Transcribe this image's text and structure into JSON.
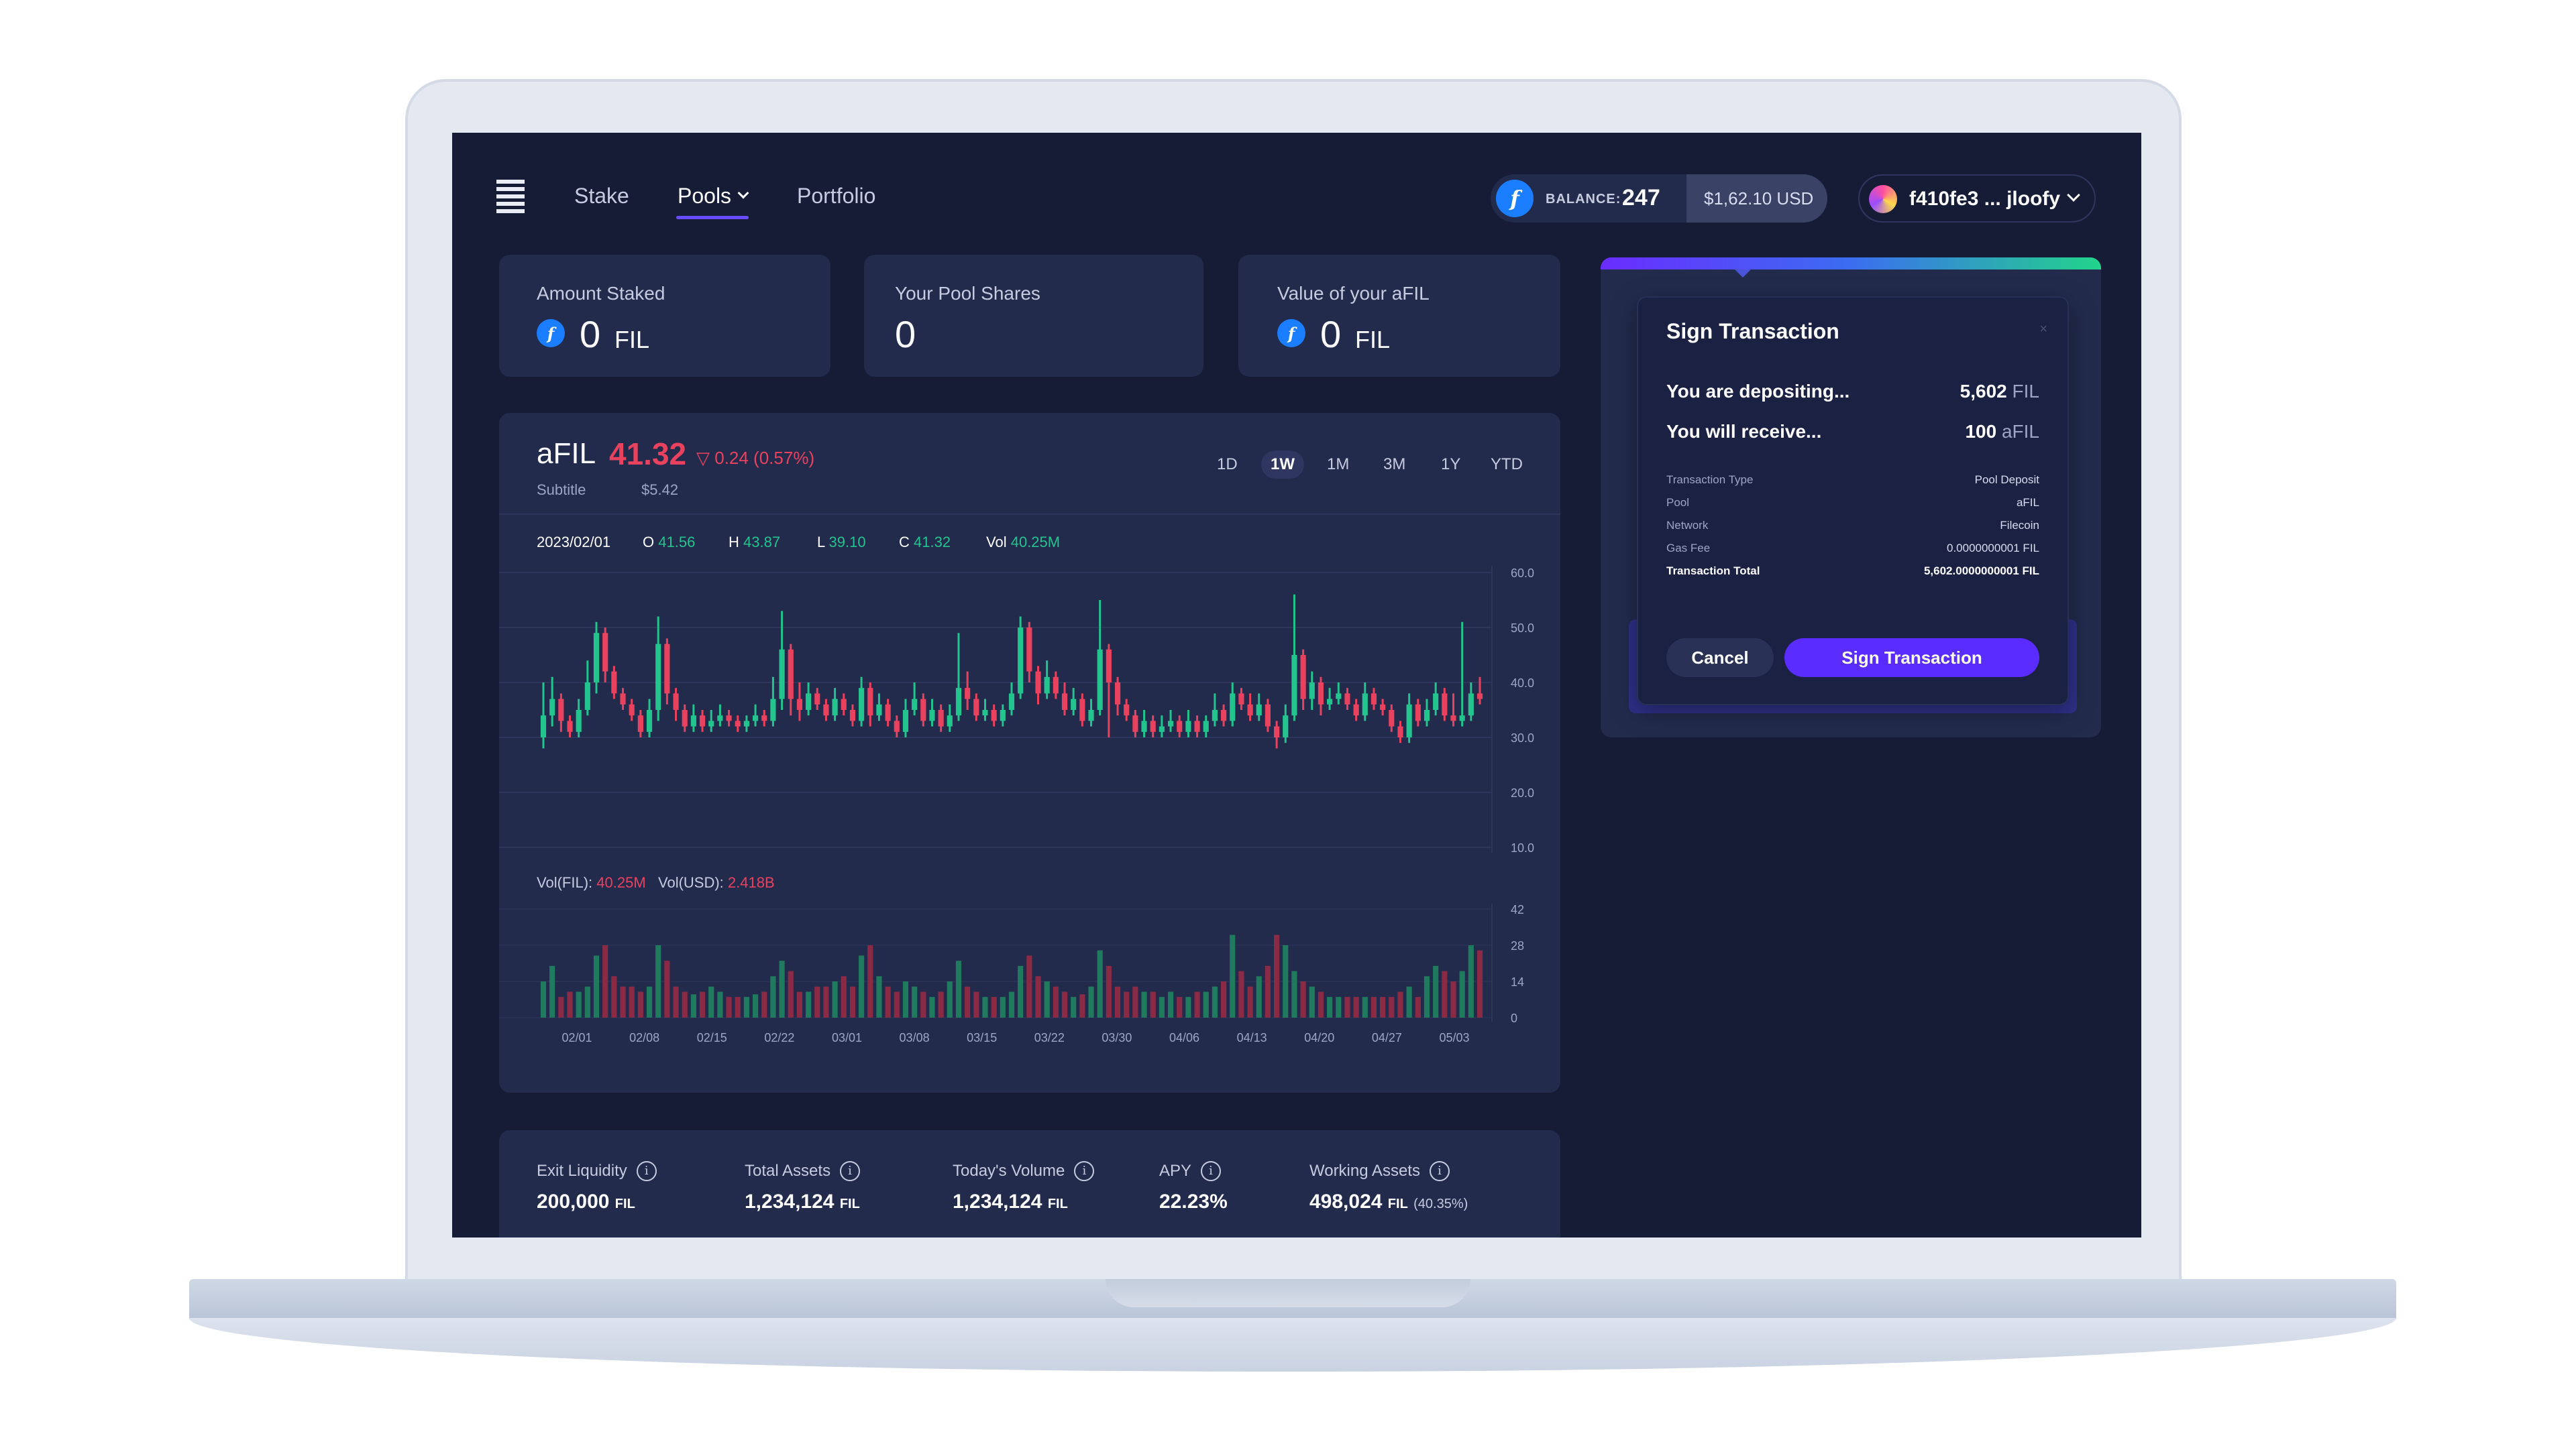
{
  "nav": {
    "items": [
      "Stake",
      "Pools",
      "Portfolio"
    ],
    "active": "Pools"
  },
  "balance": {
    "label": "BALANCE:",
    "value": "247",
    "usd": "$1,62.10 USD"
  },
  "wallet": {
    "address": "f410fe3 ... jloofy"
  },
  "stats": {
    "amount_staked": {
      "label": "Amount Staked",
      "value": "0",
      "unit": "FIL"
    },
    "pool_shares": {
      "label": "Your Pool Shares",
      "value": "0"
    },
    "afil_value": {
      "label": "Value of your aFIL",
      "value": "0",
      "unit": "FIL"
    }
  },
  "chart_header": {
    "symbol": "aFIL",
    "price": "41.32",
    "change": "0.24 (0.57%)",
    "subtitle": "Subtitle",
    "subtitle_value": "$5.42",
    "timeframes": [
      "1D",
      "1W",
      "1M",
      "3M",
      "1Y",
      "YTD"
    ],
    "active_timeframe": "1W"
  },
  "ohlc": {
    "date": "2023/02/01",
    "open_label": "O",
    "open": "41.56",
    "high_label": "H",
    "high": "43.87",
    "low_label": "L",
    "low": "39.10",
    "close_label": "C",
    "close": "41.32",
    "vol_label": "Vol",
    "vol": "40.25M"
  },
  "volume_summary": {
    "fil_label": "Vol(FIL):",
    "fil": "40.25M",
    "usd_label": "Vol(USD):",
    "usd": "2.418B"
  },
  "colors": {
    "up": "#23c48e",
    "down": "#e8425e",
    "vol_up": "#1f7a5e",
    "vol_down": "#8a2a45",
    "accent": "#5a2cff"
  },
  "chart_data": {
    "type": "candlestick",
    "price_axis": {
      "ticks": [
        "60.0",
        "50.0",
        "40.0",
        "30.0",
        "20.0",
        "10.0"
      ],
      "range": [
        10,
        60
      ]
    },
    "volume_axis": {
      "ticks": [
        "42",
        "28",
        "14",
        "0"
      ],
      "range": [
        0,
        42
      ]
    },
    "x_labels": [
      "02/01",
      "02/08",
      "02/15",
      "02/22",
      "03/01",
      "03/08",
      "03/15",
      "03/22",
      "03/30",
      "04/06",
      "04/13",
      "04/20",
      "04/27",
      "05/03"
    ],
    "candles": [
      [
        30,
        34,
        40,
        28,
        14
      ],
      [
        34,
        37,
        41,
        32,
        20
      ],
      [
        37,
        33,
        38,
        31,
        8
      ],
      [
        33,
        31,
        34,
        30,
        10
      ],
      [
        31,
        35,
        37,
        30,
        10
      ],
      [
        35,
        40,
        44,
        34,
        12
      ],
      [
        40,
        49,
        51,
        38,
        24
      ],
      [
        49,
        42,
        50,
        40,
        28
      ],
      [
        42,
        38,
        43,
        37,
        16
      ],
      [
        38,
        36,
        39,
        35,
        12
      ],
      [
        36,
        34,
        37,
        33,
        12
      ],
      [
        34,
        31,
        35,
        30,
        10
      ],
      [
        31,
        35,
        37,
        30,
        12
      ],
      [
        35,
        47,
        52,
        33,
        28
      ],
      [
        47,
        38,
        48,
        36,
        22
      ],
      [
        38,
        35,
        39,
        33,
        12
      ],
      [
        35,
        32,
        36,
        31,
        10
      ],
      [
        32,
        34,
        36,
        31,
        9
      ],
      [
        34,
        32,
        35,
        31,
        10
      ],
      [
        32,
        33,
        35,
        31,
        12
      ],
      [
        33,
        34,
        36,
        32,
        10
      ],
      [
        34,
        33,
        35,
        32,
        8
      ],
      [
        33,
        32,
        34,
        31,
        8
      ],
      [
        32,
        33,
        34,
        31,
        8
      ],
      [
        33,
        34,
        36,
        32,
        9
      ],
      [
        34,
        33,
        35,
        32,
        10
      ],
      [
        33,
        37,
        41,
        32,
        16
      ],
      [
        37,
        46,
        53,
        35,
        22
      ],
      [
        46,
        37,
        47,
        34,
        18
      ],
      [
        37,
        35,
        40,
        33,
        10
      ],
      [
        35,
        38,
        40,
        34,
        10
      ],
      [
        38,
        36,
        39,
        35,
        12
      ],
      [
        36,
        34,
        37,
        33,
        12
      ],
      [
        34,
        37,
        39,
        33,
        14
      ],
      [
        37,
        35,
        38,
        34,
        16
      ],
      [
        35,
        33,
        36,
        32,
        12
      ],
      [
        33,
        39,
        41,
        32,
        24
      ],
      [
        39,
        34,
        40,
        32,
        28
      ],
      [
        34,
        36,
        38,
        33,
        16
      ],
      [
        36,
        33,
        37,
        32,
        12
      ],
      [
        33,
        31,
        34,
        30,
        10
      ],
      [
        31,
        35,
        37,
        30,
        14
      ],
      [
        35,
        37,
        40,
        34,
        12
      ],
      [
        37,
        33,
        38,
        32,
        10
      ],
      [
        33,
        35,
        37,
        32,
        8
      ],
      [
        35,
        32,
        36,
        31,
        10
      ],
      [
        32,
        34,
        36,
        31,
        14
      ],
      [
        34,
        39,
        49,
        33,
        22
      ],
      [
        39,
        37,
        42,
        35,
        12
      ],
      [
        37,
        34,
        38,
        33,
        10
      ],
      [
        34,
        35,
        37,
        33,
        8
      ],
      [
        35,
        33,
        36,
        32,
        8
      ],
      [
        33,
        35,
        36,
        32,
        8
      ],
      [
        35,
        38,
        40,
        34,
        10
      ],
      [
        38,
        50,
        52,
        37,
        20
      ],
      [
        50,
        42,
        51,
        40,
        24
      ],
      [
        42,
        38,
        43,
        36,
        16
      ],
      [
        38,
        41,
        44,
        37,
        14
      ],
      [
        41,
        38,
        42,
        37,
        12
      ],
      [
        38,
        35,
        40,
        34,
        10
      ],
      [
        35,
        37,
        39,
        34,
        8
      ],
      [
        37,
        33,
        38,
        32,
        9
      ],
      [
        33,
        35,
        37,
        32,
        12
      ],
      [
        35,
        46,
        55,
        34,
        26
      ],
      [
        46,
        40,
        47,
        30,
        20
      ],
      [
        40,
        36,
        41,
        34,
        12
      ],
      [
        36,
        34,
        37,
        33,
        10
      ],
      [
        34,
        31,
        35,
        30,
        12
      ],
      [
        31,
        33,
        35,
        30,
        10
      ],
      [
        33,
        31,
        34,
        30,
        10
      ],
      [
        31,
        32,
        34,
        30,
        8
      ],
      [
        32,
        33,
        35,
        31,
        10
      ],
      [
        33,
        31,
        34,
        30,
        8
      ],
      [
        31,
        33,
        35,
        30,
        8
      ],
      [
        33,
        31,
        34,
        30,
        10
      ],
      [
        31,
        33,
        34,
        30,
        10
      ],
      [
        33,
        35,
        38,
        32,
        12
      ],
      [
        35,
        33,
        36,
        32,
        14
      ],
      [
        33,
        38,
        40,
        32,
        32
      ],
      [
        38,
        36,
        39,
        35,
        18
      ],
      [
        36,
        34,
        38,
        33,
        12
      ],
      [
        34,
        36,
        38,
        33,
        16
      ],
      [
        36,
        32,
        37,
        31,
        20
      ],
      [
        32,
        30,
        33,
        28,
        32
      ],
      [
        30,
        34,
        36,
        29,
        28
      ],
      [
        34,
        45,
        56,
        33,
        18
      ],
      [
        45,
        37,
        46,
        35,
        14
      ],
      [
        37,
        40,
        42,
        35,
        12
      ],
      [
        40,
        36,
        41,
        34,
        10
      ],
      [
        36,
        37,
        39,
        35,
        8
      ],
      [
        37,
        38,
        40,
        36,
        8
      ],
      [
        38,
        36,
        39,
        35,
        8
      ],
      [
        36,
        34,
        37,
        33,
        8
      ],
      [
        34,
        38,
        40,
        33,
        8
      ],
      [
        38,
        36,
        39,
        35,
        8
      ],
      [
        36,
        35,
        37,
        34,
        8
      ],
      [
        35,
        32,
        36,
        31,
        8
      ],
      [
        32,
        30,
        33,
        29,
        10
      ],
      [
        30,
        36,
        38,
        29,
        12
      ],
      [
        36,
        33,
        37,
        32,
        8
      ],
      [
        33,
        35,
        37,
        32,
        16
      ],
      [
        35,
        38,
        40,
        34,
        20
      ],
      [
        38,
        34,
        39,
        33,
        18
      ],
      [
        34,
        33,
        38,
        32,
        14
      ],
      [
        33,
        34,
        51,
        32,
        18
      ],
      [
        34,
        38,
        40,
        33,
        28
      ],
      [
        38,
        37,
        41,
        36,
        26
      ]
    ]
  },
  "sign_transaction": {
    "title": "Sign Transaction",
    "close": "×",
    "depositing_label": "You are depositing...",
    "depositing_value": "5,602",
    "depositing_unit": "FIL",
    "receive_label": "You will receive...",
    "receive_value": "100",
    "receive_unit": "aFIL",
    "rows": [
      {
        "label": "Transaction Type",
        "value": "Pool Deposit"
      },
      {
        "label": "Pool",
        "value": "aFIL"
      },
      {
        "label": "Network",
        "value": "Filecoin"
      },
      {
        "label": "Gas Fee",
        "value": "0.0000000001 FIL"
      },
      {
        "label": "Transaction Total",
        "value": "5,602.0000000001 FIL"
      }
    ],
    "cancel": "Cancel",
    "sign": "Sign Transaction"
  },
  "bottom_stats": [
    {
      "label": "Exit Liquidity",
      "value": "200,000",
      "unit": "FIL",
      "extra": ""
    },
    {
      "label": "Total Assets",
      "value": "1,234,124",
      "unit": "FIL",
      "extra": ""
    },
    {
      "label": "Today's Volume",
      "value": "1,234,124",
      "unit": "FIL",
      "extra": ""
    },
    {
      "label": "APY",
      "value": "22.23%",
      "unit": "",
      "extra": ""
    },
    {
      "label": "Working Assets",
      "value": "498,024",
      "unit": "FIL",
      "extra": "(40.35%)"
    }
  ]
}
